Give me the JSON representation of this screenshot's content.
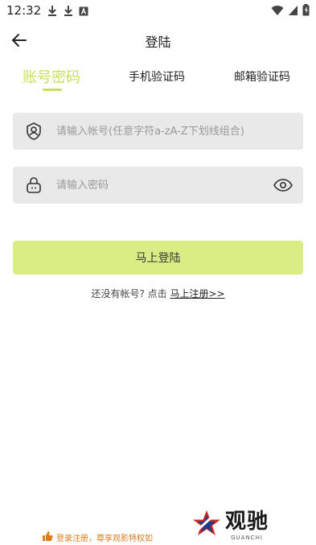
{
  "status_bar": {
    "time": "12:32"
  },
  "header": {
    "title": "登陆",
    "back_icon": "arrow-left-icon"
  },
  "tabs": [
    {
      "label": "账号密码",
      "active": true
    },
    {
      "label": "手机验证码",
      "active": false
    },
    {
      "label": "邮箱验证码",
      "active": false
    }
  ],
  "form": {
    "account_placeholder": "请输入帐号(任意字符a-zA-Z下划线组合)",
    "password_placeholder": "请输入密码",
    "account_icon": "user-shield-icon",
    "password_icon": "lock-icon",
    "visibility_icon": "eye-icon"
  },
  "login_button_label": "马上登陆",
  "register": {
    "prompt": "还没有帐号? 点击 ",
    "link": "马上注册>>"
  },
  "footer": {
    "promo_text": "登录注册，尊享观影特权如",
    "logo_text": "观驰",
    "logo_sub": "GUANCHI"
  },
  "colors": {
    "accent": "#c8e05a",
    "button_bg": "#d8ee84",
    "field_bg": "#e9e9e9",
    "promo": "#e07b1a"
  }
}
